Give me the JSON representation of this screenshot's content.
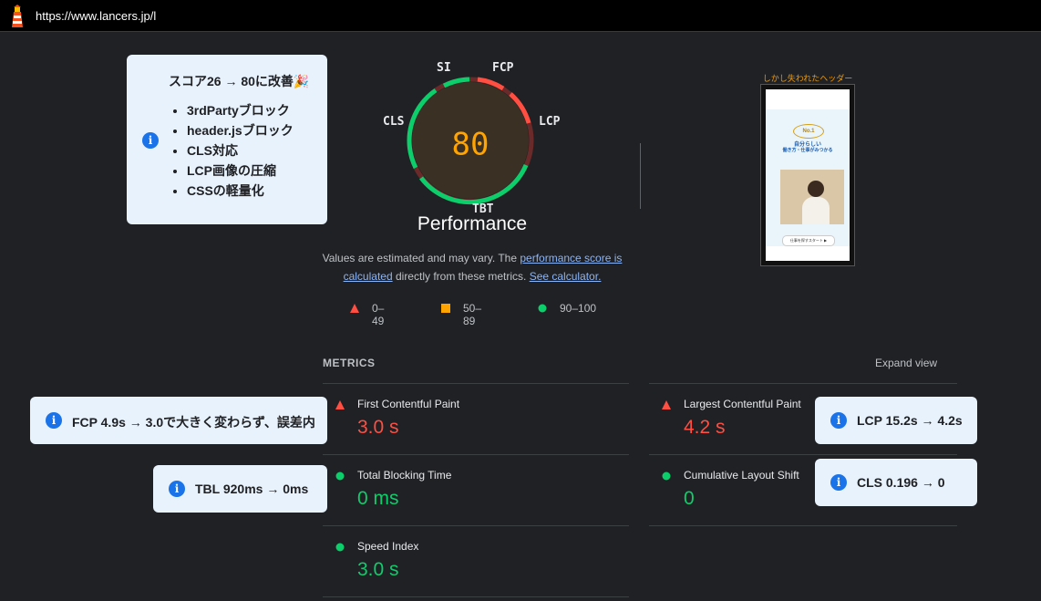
{
  "browser": {
    "url": "https://www.lancers.jp/l"
  },
  "callouts": {
    "score": {
      "title": "スコア26 → 80に改善🎉",
      "items": [
        "3rdPartyブロック",
        "header.jsブロック",
        "CLS対応",
        "LCP画像の圧縮",
        "CSSの軽量化"
      ]
    },
    "fcp": "FCP  4.9s → 3.0で大きく変わらず、誤差内",
    "tbl": "TBL 920ms → 0ms",
    "lcp": "LCP 15.2s → 4.2s",
    "cls": "CLS 0.196 → 0"
  },
  "gauge": {
    "score": "80",
    "score_value": 80,
    "title": "Performance",
    "labels": {
      "si": "SI",
      "fcp": "FCP",
      "lcp": "LCP",
      "tbt": "TBT",
      "cls": "CLS"
    },
    "colors": {
      "good": "#0cce6b",
      "poor": "#ff4e42",
      "average": "#ffa400"
    }
  },
  "note": {
    "prefix": "Values are estimated and may vary. The ",
    "link1": "performance score is calculated",
    "middle": " directly from these metrics. ",
    "link2": "See calculator."
  },
  "legend": [
    {
      "range": "0–49",
      "shape": "triangle",
      "color": "#ff4e42"
    },
    {
      "range": "50–89",
      "shape": "square",
      "color": "#ffa400"
    },
    {
      "range": "90–100",
      "shape": "circle",
      "color": "#0cce6b"
    }
  ],
  "screenshot": {
    "caption": "しかし失われたヘッダー",
    "badge": "No.1",
    "headline1": "自分らしい",
    "headline2": "働き方・仕事がみつかる",
    "button": "仕事を探すスタート ▶"
  },
  "metrics": {
    "heading": "METRICS",
    "expand": "Expand view",
    "fcp": {
      "name": "First Contentful Paint",
      "value": "3.0 s",
      "status": "poor"
    },
    "lcp": {
      "name": "Largest Contentful Paint",
      "value": "4.2 s",
      "status": "poor"
    },
    "tbt": {
      "name": "Total Blocking Time",
      "value": "0 ms",
      "status": "good"
    },
    "cls": {
      "name": "Cumulative Layout Shift",
      "value": "0",
      "status": "good"
    },
    "si": {
      "name": "Speed Index",
      "value": "3.0 s",
      "status": "good"
    }
  }
}
